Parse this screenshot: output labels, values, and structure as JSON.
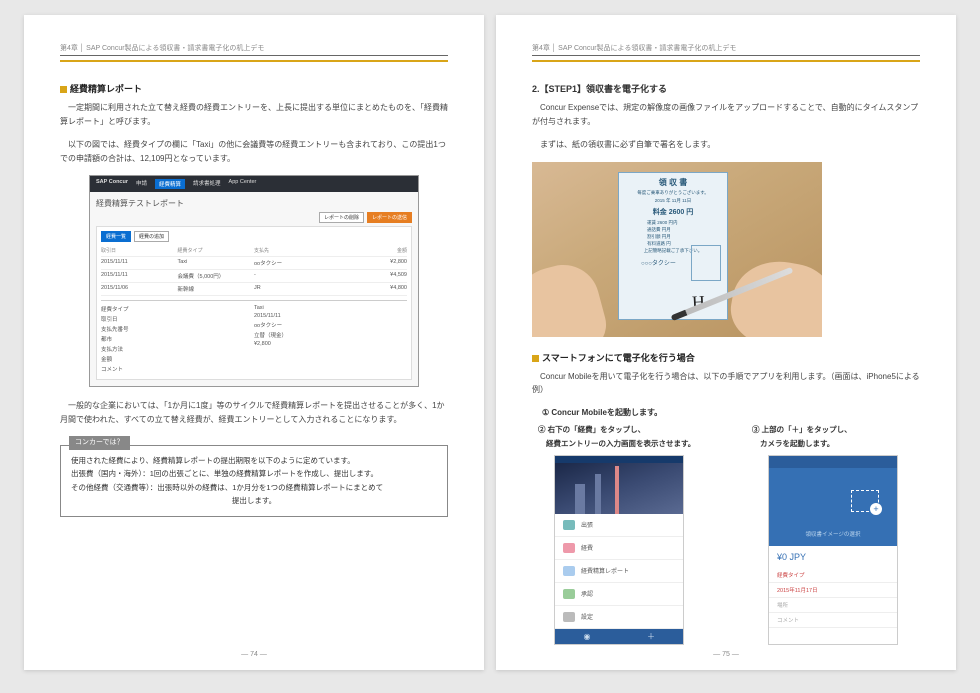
{
  "header": "第4章 │ SAP Concur製品による領収書・請求書電子化の机上デモ",
  "left": {
    "sectionTitle": "経費精算レポート",
    "p1": "一定期間に利用された立て替え経費の経費エントリーを、上長に提出する単位にまとめたものを、「経費精算レポート」と呼びます。",
    "p2": "以下の図では、経費タイプの欄に「Taxi」の他に会議費等の経費エントリーも含まれており、この提出1つでの申請額の合計は、12,109円となっています。",
    "ss": {
      "logo": "SAP Concur",
      "nav1": "申請",
      "nav2": "経費精算",
      "nav3": "請求書処理",
      "nav4": "App Center",
      "title": "経費精算テストレポート",
      "btn1": "レポートの削除",
      "btn2": "レポートの送信",
      "btnTab": "経費一覧",
      "btnAdd": "経費の追加",
      "rows": [
        {
          "date": "2015/11/11",
          "type": "Taxi",
          "vendor": "ooタクシー",
          "amt": "¥2,800"
        },
        {
          "date": "2015/11/11",
          "type": "会議費（5,000円）",
          "vendor": "-",
          "amt": "¥4,509"
        },
        {
          "date": "2015/11/06",
          "type": "新幹線",
          "vendor": "JR",
          "amt": "¥4,800"
        }
      ],
      "detailLines": [
        "経費タイプ",
        "取引日",
        "支払先番号",
        "都市",
        "支払方法",
        "金額",
        "コメント"
      ],
      "detailVals": [
        "Taxi",
        "2015/11/11",
        "ooタクシー",
        "",
        "立替（現金）",
        "¥2,800",
        ""
      ]
    },
    "p3": "一般的な企業においては、「1か月に1度」等のサイクルで経費精算レポートを提出させることが多く、1か月間で使われた、すべての立て替え経費が、経費エントリーとして入力されることになります。",
    "infoTag": "コンカーでは？",
    "infoLines": [
      "使用された経費により、経費精算レポートの提出期限を以下のように定めています。",
      "出張費（国内・海外）：1回の出張ごとに、単独の経費精算レポートを作成し、提出します。",
      "その他経費（交通費等）：出張時以外の経費は、1か月分を1つの経費精算レポートにまとめて",
      "提出します。"
    ],
    "pageNum": "74"
  },
  "right": {
    "stepTitle": "2.【STEP1】領収書を電子化する",
    "p1": "Concur Expenseでは、規定の解像度の画像ファイルをアップロードすることで、自動的にタイムスタンプが付与されます。",
    "p2": "まずは、紙の領収書に必ず自筆で署名をします。",
    "receipt": {
      "title": "領 収 書",
      "sub": "毎度ご乗車ありがとうございます。",
      "date": "2015 年 11月 11日",
      "priceLabel": "料金",
      "price": "2600 円",
      "lines": [
        "運賃    2600 円内",
        "通話費        円月",
        "割引額        円月",
        "有料道路        円"
      ],
      "note": "上記簡略記載ご了承下さい。",
      "taxi": "○○○タクシー"
    },
    "smartTitle": "スマートフォンにて電子化を行う場合",
    "p3": "Concur Mobileを用いて電子化を行う場合は、以下の手順でアプリを利用します。（画面は、iPhone5による例）",
    "n1": "① Concur Mobileを起動します。",
    "phoneL": {
      "label": "② 右下の「経費」をタップし、",
      "sublabel": "経費エントリーの入力画面を表示させます。",
      "items": [
        "出張",
        "経費",
        "経費精算レポート",
        "承認",
        "設定"
      ]
    },
    "phoneR": {
      "label": "③ 上部の「＋」をタップし、",
      "sublabel": "カメラを起動します。",
      "imgLabel": "領収書イメージの選択",
      "amount": "¥0 JPY",
      "f1": "経費タイプ",
      "f2": "2015年11月17日",
      "f3": "場所",
      "f4": "コメント"
    },
    "pageNum": "75"
  }
}
